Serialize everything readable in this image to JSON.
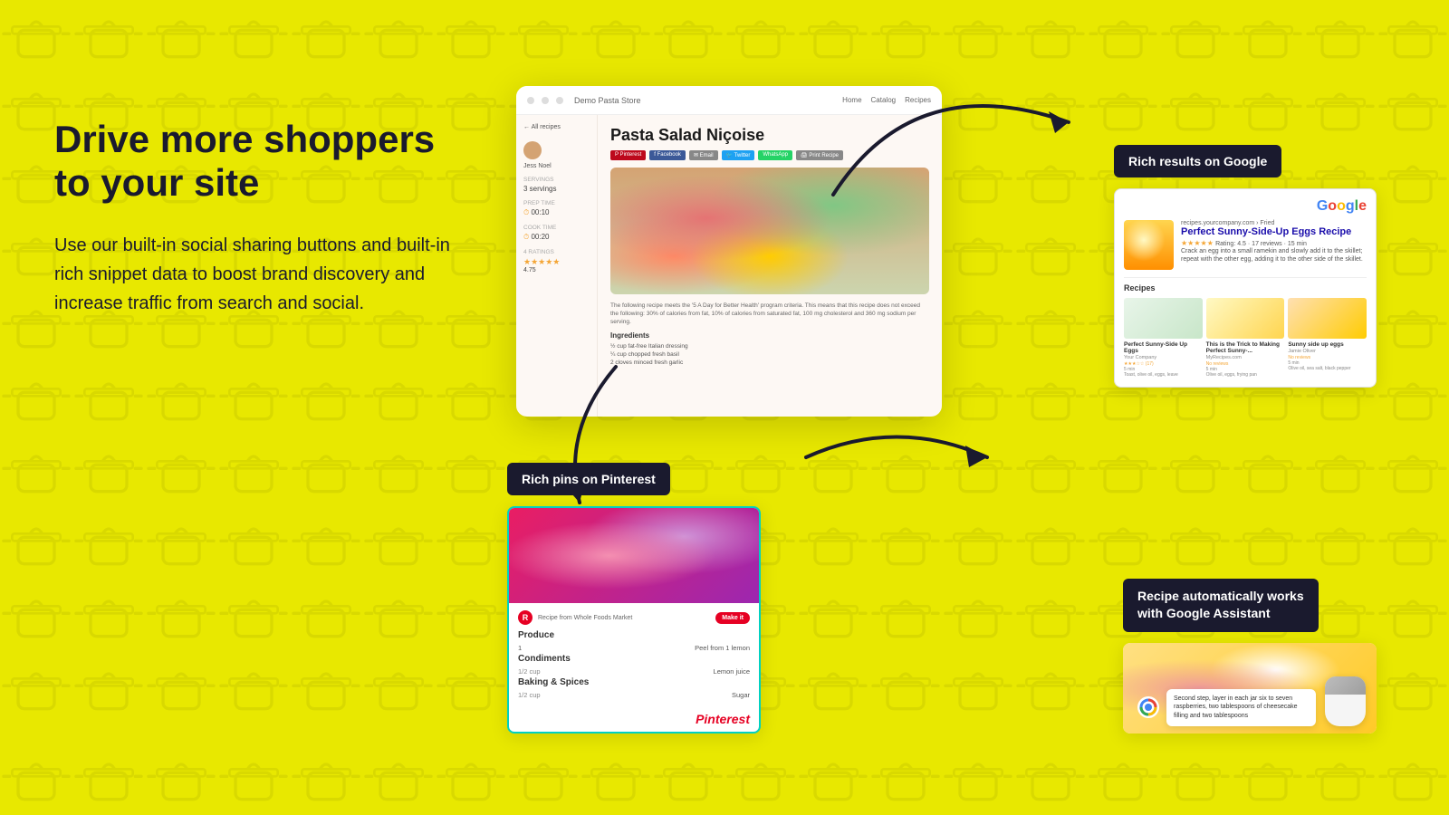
{
  "background_color": "#E8E800",
  "left_panel": {
    "heading_line1": "Drive more shoppers",
    "heading_line2": "to your site",
    "body_text": "Use our built-in social sharing buttons and built-in rich snippet data to boost brand discovery and increase traffic from search and social."
  },
  "recipe_card": {
    "store_name": "Demo Pasta Store",
    "nav_items": [
      "Home",
      "Catalog",
      "Recipes"
    ],
    "back_link": "All recipes",
    "title": "Pasta Salad Niçoise",
    "author": "Jess Noel",
    "servings_label": "Servings",
    "servings_value": "3 servings",
    "prep_label": "Prep time",
    "prep_value": "00:10",
    "cook_label": "Cook time",
    "cook_value": "00:20",
    "rating_label": "4 Ratings",
    "rating_value": "4.75",
    "share_buttons": [
      "Pinterest",
      "Facebook",
      "Email",
      "Twitter",
      "WhatsApp",
      "Print Recipe"
    ],
    "description": "The following recipe meets the '5 A Day for Better Health' program criteria. This means that this recipe does not exceed the following: 30% of calories from fat, 10% of calories from saturated fat, 100 mg cholesterol and 360 mg sodium per serving.",
    "ingredients_heading": "Ingredients",
    "ingredients": [
      "½ cup fat-free Italian dressing",
      "¼ cup chopped fresh basil",
      "2 cloves minced fresh garlic"
    ]
  },
  "google_label": "Rich results on Google",
  "google_result": {
    "url": "recipes.yourcompany.com › Fried",
    "title": "Perfect Sunny-Side-Up Eggs Recipe",
    "stars": "★★★★★",
    "rating_text": "Rating: 4.5 · 17 reviews · 15 min",
    "description": "Crack an egg into a small ramekin and slowly add it to the skillet; repeat with the other egg, adding it to the other side of the skillet.",
    "section_label": "Recipes",
    "recipes": [
      {
        "title": "Perfect Sunny-Side Up Eggs",
        "source": "Your Company",
        "rating": "★★★☆☆",
        "reviews": "(17)",
        "time": "5 min",
        "tags": "Toast, olive oil, eggs, leave"
      },
      {
        "title": "This is the Trick to Making Perfect Sunny-...",
        "source": "MyRecipes.com",
        "rating": "☆☆☆☆☆",
        "reviews": "No reviews",
        "time": "5 min",
        "tags": "Olive oil, eggs, frying pan"
      },
      {
        "title": "Sunny side up eggs",
        "source": "Jamie Oliver",
        "rating": "☆☆☆☆☆",
        "reviews": "No reviews",
        "time": "5 min",
        "tags": "Olive oil, sea salt, black pepper"
      }
    ]
  },
  "pinterest_label": "Rich pins on Pinterest",
  "pinterest_card": {
    "from_text": "Recipe from  Whole Foods Market",
    "make_btn": "Make it",
    "produce_section": "Produce",
    "produce_items": [
      {
        "qty": "1",
        "name": "Peel from 1 lemon"
      }
    ],
    "condiments_section": "Condiments",
    "condiment_items": [
      {
        "qty": "1/2 cup",
        "name": "Lemon juice"
      }
    ],
    "baking_section": "Baking & Spices",
    "baking_items": [
      {
        "qty": "1/2 cup",
        "name": "Sugar"
      }
    ]
  },
  "assistant_label_line1": "Recipe automatically works",
  "assistant_label_line2": "with Google Assistant",
  "assistant_card": {
    "bubble_text": "Second step, layer in each jar six to seven raspberries, two tablespoons of cheesecake filling and two tablespoons"
  }
}
